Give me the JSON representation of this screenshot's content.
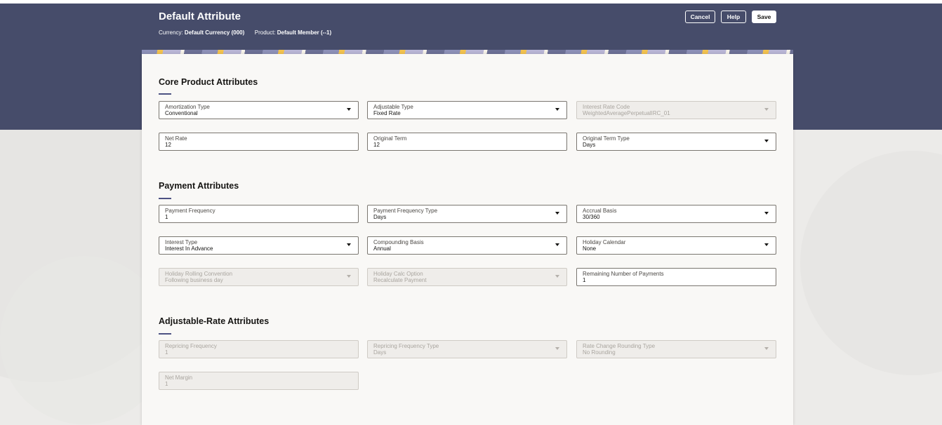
{
  "header": {
    "title": "Default Attribute",
    "currency_label": "Currency:",
    "currency_value": "Default Currency (000)",
    "product_label": "Product:",
    "product_value": "Default Member (--1)",
    "cancel_label": "Cancel",
    "help_label": "Help",
    "save_label": "Save"
  },
  "sections": {
    "core": {
      "title": "Core Product Attributes",
      "fields": [
        {
          "label": "Amortization Type",
          "value": "Conventional"
        },
        {
          "label": "Adjustable Type",
          "value": "Fixed Rate"
        },
        {
          "label": "Interest Rate Code",
          "value": "WeightedAveragePerpetualIRC_01"
        },
        {
          "label": "Net Rate",
          "value": "12"
        },
        {
          "label": "Original Term",
          "value": "12"
        },
        {
          "label": "Original Term Type",
          "value": "Days"
        }
      ]
    },
    "payment": {
      "title": "Payment Attributes",
      "fields": [
        {
          "label": "Payment Frequency",
          "value": "1"
        },
        {
          "label": "Payment Frequency Type",
          "value": "Days"
        },
        {
          "label": "Accrual Basis",
          "value": "30/360"
        },
        {
          "label": "Interest Type",
          "value": "Interest In Advance"
        },
        {
          "label": "Compounding Basis",
          "value": "Annual"
        },
        {
          "label": "Holiday Calendar",
          "value": "None"
        },
        {
          "label": "Holiday Rolling Convention",
          "value": "Following business day"
        },
        {
          "label": "Holiday Calc Option",
          "value": "Recalculate Payment"
        },
        {
          "label": "Remaining Number of Payments",
          "value": "1"
        }
      ]
    },
    "adjustable": {
      "title": "Adjustable-Rate Attributes",
      "fields": [
        {
          "label": "Repricing Frequency",
          "value": "1"
        },
        {
          "label": "Repricing Frequency Type",
          "value": "Days"
        },
        {
          "label": "Rate Change Rounding Type",
          "value": "No Rounding"
        },
        {
          "label": "Net Margin",
          "value": "1"
        }
      ]
    }
  },
  "colors": {
    "header_band": "#464c6a",
    "accent_rule": "#4d5283",
    "card": "#f9f8f6",
    "page_bg": "#ecebe9"
  }
}
